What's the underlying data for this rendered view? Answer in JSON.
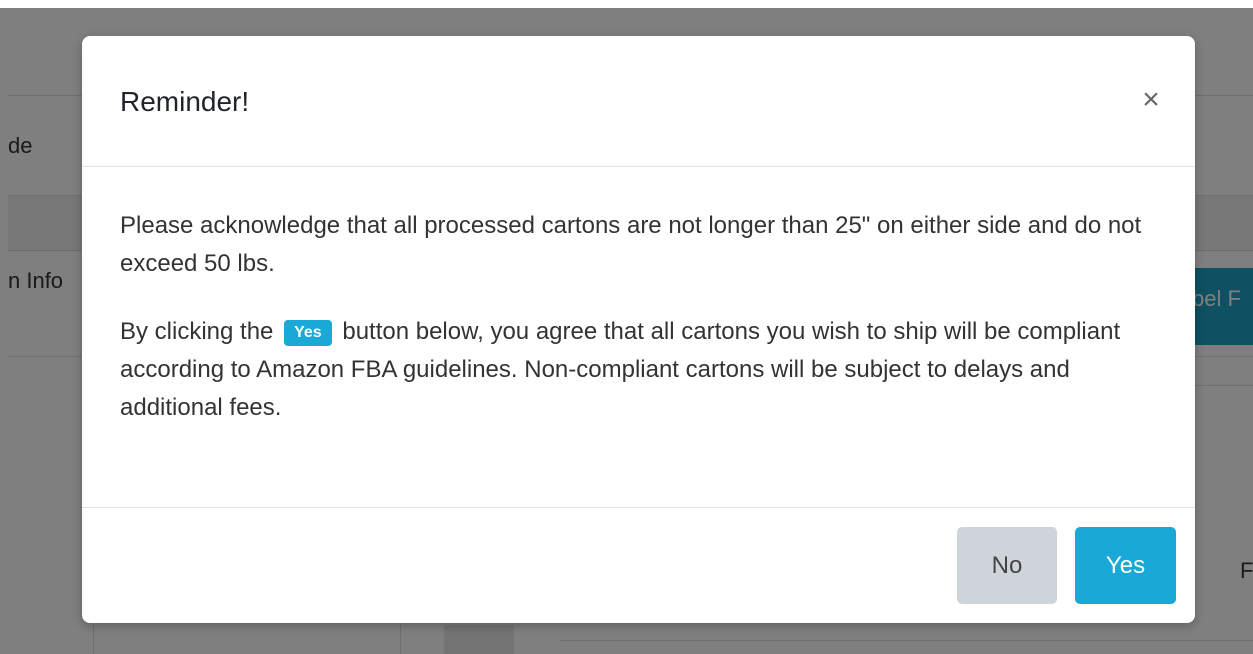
{
  "background": {
    "partial_text_1": "de",
    "partial_text_2": "n Info",
    "partial_teal_text": "bel F",
    "partial_letter": "F"
  },
  "modal": {
    "title": "Reminder!",
    "close_symbol": "×",
    "paragraph1": "Please acknowledge that all processed cartons are not longer than 25\" on either side and do not exceed 50 lbs.",
    "paragraph2_before": "By clicking the",
    "paragraph2_badge": "Yes",
    "paragraph2_after": "button below, you agree that all cartons you wish to ship will be compliant according to Amazon FBA guidelines. Non-compliant cartons will be subject to delays and additional fees.",
    "no_label": "No",
    "yes_label": "Yes"
  },
  "colors": {
    "primary": "#1aa8d6",
    "secondary": "#ced4da",
    "backdrop": "rgba(0,0,0,0.5)"
  }
}
